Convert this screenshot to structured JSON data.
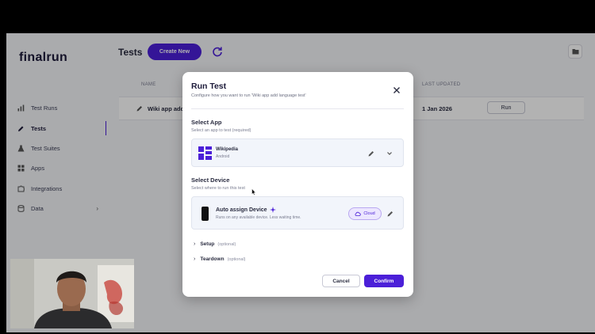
{
  "sidebar": {
    "logo_a": "final",
    "logo_b": "run",
    "items": [
      {
        "label": "Test Runs",
        "icon": "bar-chart-icon"
      },
      {
        "label": "Tests",
        "icon": "pencil-icon"
      },
      {
        "label": "Test Suites",
        "icon": "flask-icon"
      },
      {
        "label": "Apps",
        "icon": "grid-icon"
      },
      {
        "label": "Integrations",
        "icon": "puzzle-icon"
      },
      {
        "label": "Data",
        "icon": "database-icon"
      }
    ]
  },
  "header": {
    "title": "Tests",
    "create_label": "Create New"
  },
  "table": {
    "col_name": "NAME",
    "col_updated": "LAST UPDATED",
    "rows": [
      {
        "name": "Wiki app add",
        "updated": "1 Jan 2026",
        "action": "Run"
      }
    ]
  },
  "modal": {
    "title": "Run Test",
    "subtitle": "Configure how you want to run 'Wiki app add language test'",
    "select_app": {
      "title": "Select App",
      "subtitle": "Select an app to test (required)",
      "app_name": "Wikipedia",
      "platform": "Android"
    },
    "select_device": {
      "title": "Select Device",
      "subtitle": "Select where to run this test",
      "device_name": "Auto assign Device",
      "device_desc": "Runs on any available device. Less waiting time.",
      "badge": "Cloud"
    },
    "setup": {
      "label": "Setup",
      "optional": "(optional)"
    },
    "teardown": {
      "label": "Teardown",
      "optional": "(optional)"
    },
    "cancel_label": "Cancel",
    "confirm_label": "Confirm"
  },
  "colors": {
    "accent": "#4b1fd8",
    "badge_bg": "#ece6ff"
  }
}
